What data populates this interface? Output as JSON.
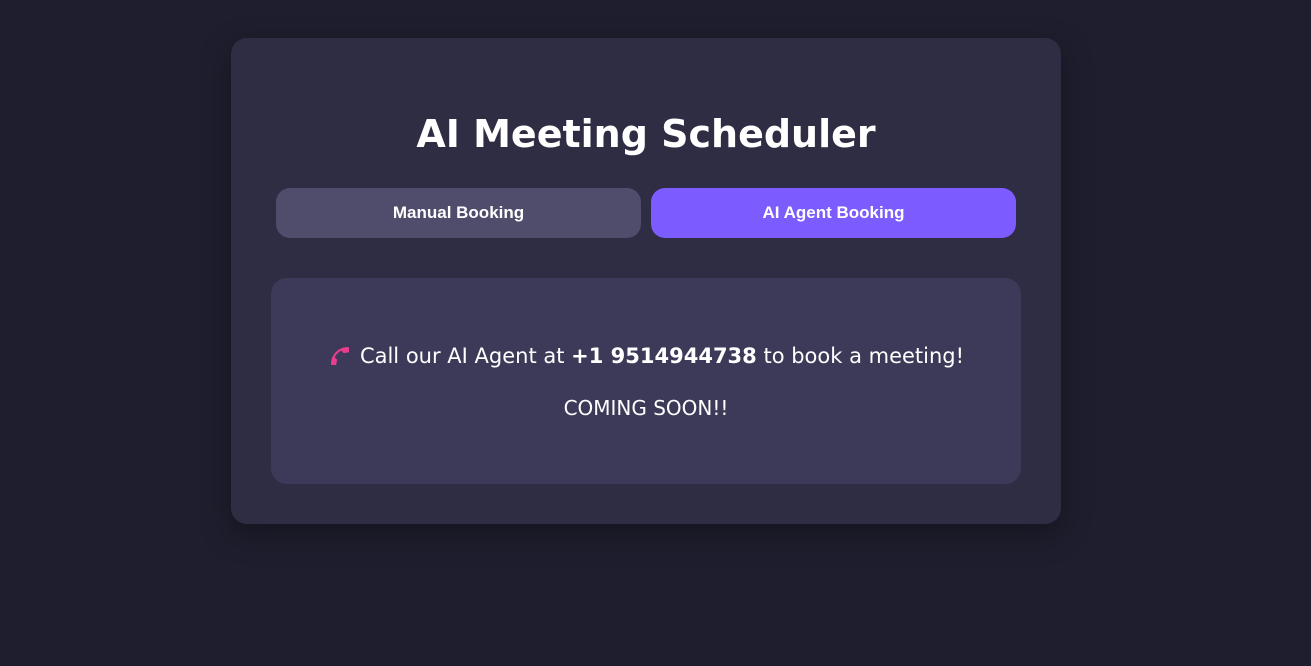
{
  "app": {
    "title": "AI Meeting Scheduler"
  },
  "tabs": {
    "manual_label": "Manual Booking",
    "ai_label": "AI Agent Booking",
    "active": "AI Agent Booking"
  },
  "ai_panel": {
    "icon": "phone-icon",
    "call_prefix": "Call our AI Agent at ",
    "phone_number": "+1 9514944738",
    "call_suffix": " to book a meeting!",
    "status": "COMING SOON!!"
  },
  "colors": {
    "background": "#1f1e2e",
    "card": "#2e2d43",
    "panel": "#3c3a58",
    "tab_inactive": "#4f4d6b",
    "tab_active": "#7c5cff",
    "phone_icon": "#e83e8c"
  }
}
